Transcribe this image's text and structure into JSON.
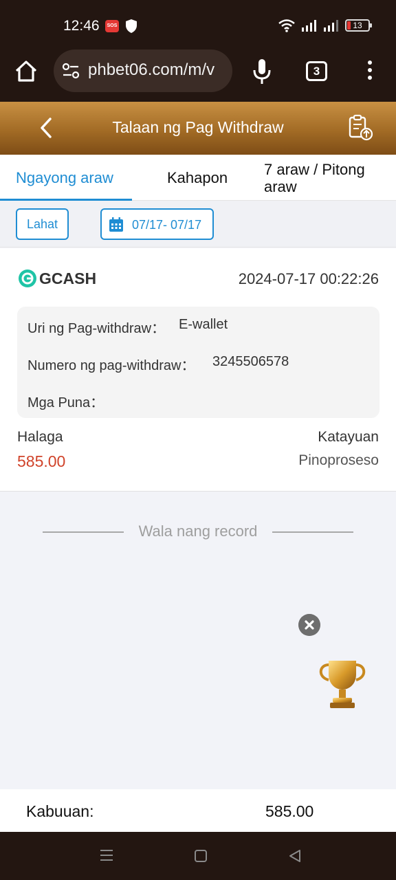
{
  "status_bar": {
    "time": "12:46",
    "sos_badge": "SOS",
    "battery": "13"
  },
  "browser": {
    "url": "phbet06.com/m/v",
    "tab_count": "3"
  },
  "header": {
    "title": "Talaan ng Pag Withdraw"
  },
  "tabs": [
    {
      "label": "Ngayong araw"
    },
    {
      "label": "Kahapon"
    },
    {
      "label": "7 araw / Pitong araw"
    }
  ],
  "filters": {
    "all_label": "Lahat",
    "date_range": "07/17- 07/17"
  },
  "record": {
    "provider": "GCASH",
    "datetime": "2024-07-17 00:22:26",
    "details": {
      "type_label": "Uri ng Pag-withdraw：",
      "type_value": "E-wallet",
      "number_label": "Numero ng pag-withdraw：",
      "number_value": "3245506578",
      "remarks_label": "Mga Puna：",
      "remarks_value": ""
    },
    "amount_label": "Halaga",
    "amount_value": "585.00",
    "status_label": "Katayuan",
    "status_value": "Pinoproseso"
  },
  "empty_text": "Wala nang record",
  "footer": {
    "total_label": "Kabuuan:",
    "total_value": "585.00"
  },
  "colors": {
    "accent_blue": "#1f8dd3",
    "amount_red": "#d0432a",
    "header_gold": "#a26b25",
    "dark_bar": "#231611"
  }
}
